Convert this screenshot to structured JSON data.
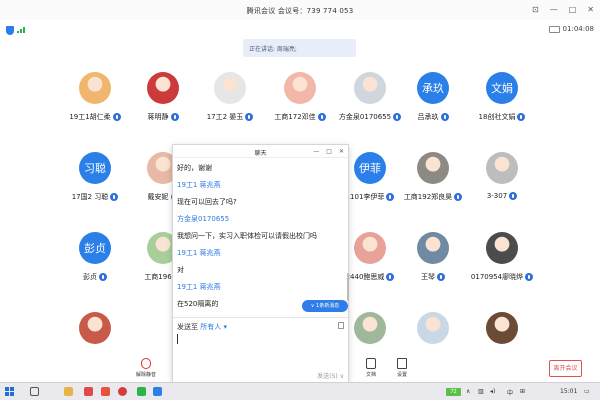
{
  "window": {
    "title": "腾讯会议 会议号：739 774 053",
    "timer": "01:04:08",
    "speaking": "正在讲话: 周瑞亮;"
  },
  "participants": [
    {
      "name": "19工1胡仁柔",
      "avatar_type": "photo",
      "avatar_color": "#f0b66d"
    },
    {
      "name": "蒋明静",
      "avatar_type": "photo",
      "avatar_color": "#cc3b3b"
    },
    {
      "name": "17工2 晏玉",
      "avatar_type": "photo",
      "avatar_color": "#e6e6e6"
    },
    {
      "name": "工商172邓佳",
      "avatar_type": "photo",
      "avatar_color": "#f2b7a8"
    },
    {
      "name": "方金泉0170655",
      "avatar_type": "photo",
      "avatar_color": "#d0d6dd"
    },
    {
      "name": "吕承玖",
      "avatar_type": "text",
      "avatar_text": "承玖"
    },
    {
      "name": "18创社文娟",
      "avatar_type": "text",
      "avatar_text": "文娟"
    },
    {
      "name": "17国2 习聪",
      "avatar_type": "text",
      "avatar_text": "习聪"
    },
    {
      "name": "戴安妮",
      "avatar_type": "photo",
      "avatar_color": "#e8b9a6"
    },
    {
      "name": "1101李伊菲",
      "avatar_type": "text",
      "avatar_text": "伊菲"
    },
    {
      "name": "工商192郑良昊",
      "avatar_type": "photo",
      "avatar_color": "#8d8a84"
    },
    {
      "name": "3-307",
      "avatar_type": "photo",
      "avatar_color": "#bdbdbd"
    },
    {
      "name": "彭贞",
      "avatar_type": "text",
      "avatar_text": "彭贞"
    },
    {
      "name": "工商196",
      "avatar_type": "photo",
      "avatar_color": "#a8cf9a"
    },
    {
      "name": "2440鲍思威",
      "avatar_type": "photo",
      "avatar_color": "#e7a39a"
    },
    {
      "name": "王琴",
      "avatar_type": "photo",
      "avatar_color": "#6f8aa1"
    },
    {
      "name": "0170954廖晓烨",
      "avatar_type": "photo",
      "avatar_color": "#4c4c4c"
    },
    {
      "name": "",
      "avatar_type": "photo",
      "avatar_color": "#c85a4a"
    },
    {
      "name": "",
      "avatar_type": "photo",
      "avatar_color": "#8e6f5a"
    },
    {
      "name": "",
      "avatar_type": "photo",
      "avatar_color": "#9fb79a"
    },
    {
      "name": "",
      "avatar_type": "photo",
      "avatar_color": "#c9d7e6"
    },
    {
      "name": "",
      "avatar_type": "photo",
      "avatar_color": "#6b4a36"
    }
  ],
  "chat": {
    "title": "聊天",
    "messages": [
      {
        "text": "好的，谢谢",
        "sender": false
      },
      {
        "text": "19工1 蒋兆燕",
        "sender": true
      },
      {
        "text": "现在可以回去了吗?",
        "sender": false
      },
      {
        "text": "方金泉0170655",
        "sender": true
      },
      {
        "text": "我想问一下，实习入职体检可以请假出校门吗",
        "sender": false
      },
      {
        "text": "19工1 蒋兆燕",
        "sender": true
      },
      {
        "text": "对",
        "sender": false
      },
      {
        "text": "19工1 蒋兆燕",
        "sender": true
      },
      {
        "text": "在520隔离的",
        "sender": false
      },
      {
        "text": "19工1 蒋兆燕",
        "sender": true
      }
    ],
    "new_msg": "∨ 1条新消息",
    "send_to_label": "发送至",
    "send_to_target": "所有人",
    "send_button": "发送(S)"
  },
  "toolbar": {
    "mute_label": "解除静音",
    "docs_label": "文档",
    "settings_label": "设置",
    "leave_label": "离开会议"
  },
  "taskbar": {
    "battery": "72",
    "ime": "中",
    "clock": "15:01"
  }
}
